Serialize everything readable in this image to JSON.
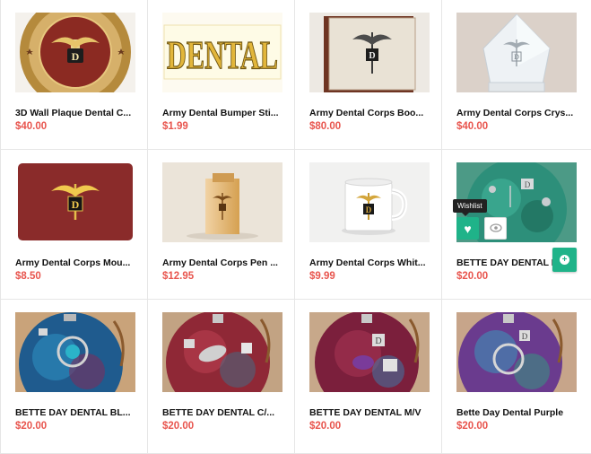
{
  "products": [
    {
      "title": "3D Wall Plaque Dental C...",
      "price": "$40.00",
      "image_icon": "wall-plaque-image"
    },
    {
      "title": "Army Dental Bumper Sti...",
      "price": "$1.99",
      "image_icon": "bumper-sticker-image",
      "image_text": "DENTAL"
    },
    {
      "title": "Army Dental Corps Boo...",
      "price": "$80.00",
      "image_icon": "bookend-image"
    },
    {
      "title": "Army Dental Corps Crys...",
      "price": "$40.00",
      "image_icon": "crystal-award-image"
    },
    {
      "title": "Army Dental Corps Mou...",
      "price": "$8.50",
      "image_icon": "mouse-pad-image"
    },
    {
      "title": "Army Dental Corps Pen ...",
      "price": "$12.95",
      "image_icon": "pen-holder-image"
    },
    {
      "title": "Army Dental Corps Whit...",
      "price": "$9.99",
      "image_icon": "white-mug-image"
    },
    {
      "title": "BETTE DAY DENTAL B/G",
      "price": "$20.00",
      "image_icon": "ornament-teal-image"
    },
    {
      "title": "BETTE DAY DENTAL BL...",
      "price": "$20.00",
      "image_icon": "ornament-blue-image"
    },
    {
      "title": "BETTE DAY DENTAL C/...",
      "price": "$20.00",
      "image_icon": "ornament-red-image"
    },
    {
      "title": "BETTE DAY DENTAL M/V",
      "price": "$20.00",
      "image_icon": "ornament-maroon-image"
    },
    {
      "title": "Bette Day Dental Purple",
      "price": "$20.00",
      "image_icon": "ornament-purple-image"
    }
  ],
  "hover_actions": {
    "tooltip": "Wishlist",
    "wishlist_icon": "heart-icon",
    "quickview_icon": "eye-icon",
    "cart_icon": "add-to-cart-icon"
  },
  "colors": {
    "price": "#e8554e",
    "accent": "#1fb389",
    "border": "#e6e6e6"
  }
}
